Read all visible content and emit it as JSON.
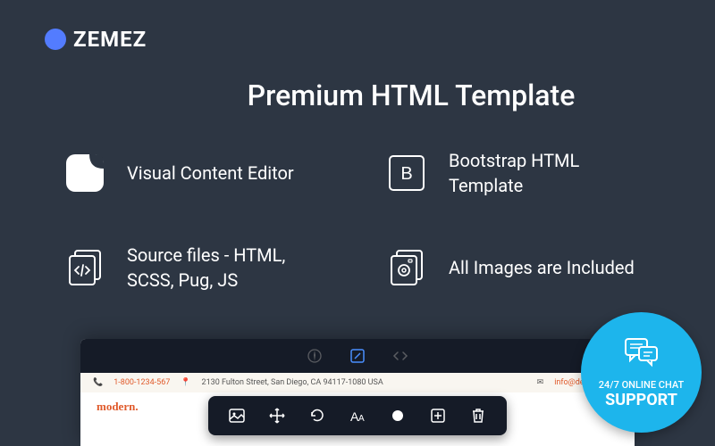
{
  "logo": {
    "name": "ZEMEZ"
  },
  "title": "Premium HTML Template",
  "features": [
    {
      "icon": "shape-icon",
      "text": "Visual Content Editor"
    },
    {
      "icon": "bootstrap-icon",
      "text": "Bootstrap HTML Template"
    },
    {
      "icon": "source-icon",
      "text": "Source files - HTML, SCSS, Pug, JS"
    },
    {
      "icon": "images-icon",
      "text": "All Images are Included"
    }
  ],
  "preview": {
    "bar_phone": "1-800-1234-567",
    "bar_address": "2130 Fulton Street, San Diego, CA 94117-1080 USA",
    "bar_email": "info@demolink.org",
    "brand": "modern."
  },
  "support": {
    "line1": "24/7 ONLINE CHAT",
    "line2": "SUPPORT"
  }
}
